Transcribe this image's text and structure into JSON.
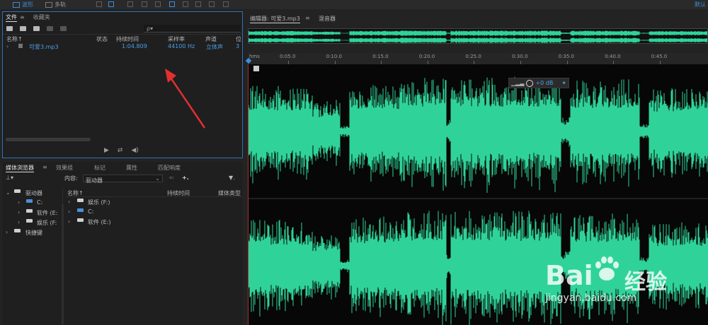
{
  "toolbar": {
    "waveform_label": "波形",
    "multitrack_label": "多轨",
    "right_label": "默认"
  },
  "files_panel": {
    "tabs": [
      {
        "label": "文件"
      },
      {
        "label": "收藏夹"
      }
    ],
    "menu_glyph": "≡",
    "search_placeholder": "ρ▾",
    "columns": {
      "name": "名称",
      "name_sort": "↑",
      "status": "状态",
      "duration": "持续时间",
      "sample_rate": "采样率",
      "channels": "声道",
      "bit": "位"
    },
    "files": [
      {
        "name": "可爱3.mp3",
        "duration": "1:04.809",
        "sample_rate": "44100 Hz",
        "channels": "立体声",
        "bit": "3"
      }
    ]
  },
  "media_panel": {
    "tabs": [
      {
        "label": "媒体浏览器"
      },
      {
        "label": "效果组"
      },
      {
        "label": "标记"
      },
      {
        "label": "属性"
      },
      {
        "label": "匹配响度"
      }
    ],
    "menu_glyph": "≡",
    "content_label": "内容:",
    "content_value": "驱动器",
    "tree": [
      {
        "label": "驱动器",
        "indent": 0
      },
      {
        "label": "C:",
        "indent": 1
      },
      {
        "label": "软件 (E:",
        "indent": 1
      },
      {
        "label": "娱乐 (F:",
        "indent": 1
      },
      {
        "label": "快捷键",
        "indent": 0
      }
    ],
    "list_columns": {
      "name": "名称",
      "name_sort": "↑",
      "duration": "持续时间",
      "media_type": "媒体类型"
    },
    "list": [
      {
        "label": "娱乐 (F:)"
      },
      {
        "label": "C:"
      },
      {
        "label": "软件 (E:)"
      }
    ]
  },
  "editor": {
    "tab_label": "编辑器: 可爱3.mp3",
    "tab_menu": "≡",
    "mixer_label": "混音器",
    "ruler_unit": "hms",
    "ruler_labels": [
      "0:05.0",
      "0:10.0",
      "0:15.0",
      "0:20.0",
      "0:25.0",
      "0:30.0",
      "0:35.0",
      "0:40.0",
      "0:45.0"
    ],
    "hud_value": "+0 dB",
    "waveform_color": "#2fd39a",
    "waveform_regions": [
      [
        0.0,
        0.14,
        0.8
      ],
      [
        0.14,
        0.2,
        0.55
      ],
      [
        0.2,
        0.22,
        0.1
      ],
      [
        0.22,
        0.33,
        0.85
      ],
      [
        0.33,
        0.43,
        0.95
      ],
      [
        0.43,
        0.44,
        0.2
      ],
      [
        0.44,
        0.68,
        0.95
      ],
      [
        0.68,
        0.7,
        0.25
      ],
      [
        0.7,
        0.85,
        0.9
      ],
      [
        0.85,
        0.87,
        0.15
      ],
      [
        0.87,
        1.0,
        0.75
      ]
    ]
  },
  "watermark": {
    "main": "Bai",
    "cn": "经验",
    "url": "jingyan.baidu.com"
  },
  "colors": {
    "accent": "#3b8fdc",
    "file_text": "#4b9fea",
    "waveform": "#2fd39a",
    "panel_border": "#2d72b8"
  }
}
